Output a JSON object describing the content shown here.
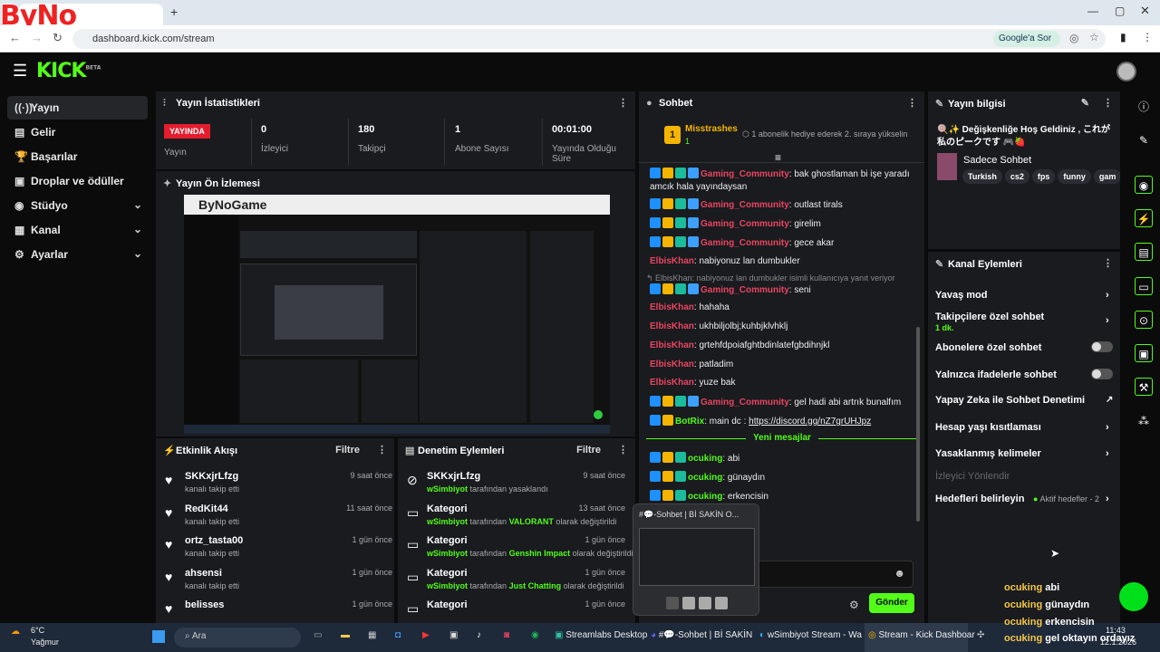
{
  "browser": {
    "tab_title": "",
    "url": "dashboard.kick.com/stream",
    "google_button": "Google'a Sor",
    "overlay_logo": "ByNo"
  },
  "kick": {
    "logo": "KICK",
    "beta": "BETA"
  },
  "sidebar": {
    "items": [
      {
        "label": "Yayın",
        "icon": "broadcast-icon",
        "active": true
      },
      {
        "label": "Gelir",
        "icon": "income-icon"
      },
      {
        "label": "Başarılar",
        "icon": "trophy-icon"
      },
      {
        "label": "Droplar ve ödüller",
        "icon": "gift-icon"
      },
      {
        "label": "Stüdyo",
        "icon": "studio-icon",
        "expand": true
      },
      {
        "label": "Kanal",
        "icon": "channel-icon",
        "expand": true
      },
      {
        "label": "Ayarlar",
        "icon": "gear-icon",
        "expand": true
      }
    ]
  },
  "stats": {
    "title": "Yayın İstatistikleri",
    "live_badge": "YAYINDA",
    "items": [
      {
        "label": "Yayın",
        "value": ""
      },
      {
        "label": "İzleyici",
        "value": "0"
      },
      {
        "label": "Takipçi",
        "value": "180"
      },
      {
        "label": "Abone Sayısı",
        "value": "1"
      },
      {
        "label": "Yayında Olduğu Süre",
        "value": "00:01:00"
      }
    ]
  },
  "preview": {
    "title": "Yayın Ön İzlemesi",
    "watermark": "ByNoGame"
  },
  "activity": {
    "title": "Etkinlik Akışı",
    "filter": "Filtre",
    "items": [
      {
        "name": "SKKxjrLfzg",
        "desc": "kanalı takip etti",
        "time": "9 saat önce"
      },
      {
        "name": "RedKit44",
        "desc": "kanalı takip etti",
        "time": "11 saat önce"
      },
      {
        "name": "ortz_tasta00",
        "desc": "kanalı takip etti",
        "time": "1 gün önce"
      },
      {
        "name": "ahsensi",
        "desc": "kanalı takip etti",
        "time": "1 gün önce"
      },
      {
        "name": "belisses",
        "desc": "",
        "time": "1 gün önce"
      }
    ]
  },
  "moderation": {
    "title": "Denetim Eylemleri",
    "filter": "Filtre",
    "items": [
      {
        "title": "SKKxjrLfzg",
        "actor": "wSimbiyot",
        "pre": " tarafından yasaklandı",
        "hl": "",
        "post": "",
        "time": "9 saat önce",
        "icon": "ban-icon"
      },
      {
        "title": "Kategori",
        "actor": "wSimbiyot",
        "pre": " tarafından ",
        "hl": "VALORANT",
        "post": " olarak değiştirildi",
        "time": "13 saat önce",
        "icon": "category-icon"
      },
      {
        "title": "Kategori",
        "actor": "wSimbiyot",
        "pre": " tarafından ",
        "hl": "Genshin Impact",
        "post": " olarak değiştirildi",
        "time": "1 gün önce",
        "icon": "category-icon"
      },
      {
        "title": "Kategori",
        "actor": "wSimbiyot",
        "pre": " tarafından ",
        "hl": "Just Chatting",
        "post": " olarak değiştirildi",
        "time": "1 gün önce",
        "icon": "category-icon"
      },
      {
        "title": "Kategori",
        "actor": "",
        "pre": "",
        "hl": "",
        "post": "",
        "time": "1 gün önce",
        "icon": "category-icon"
      }
    ]
  },
  "chat": {
    "title": "Sohbet",
    "pinned_user": "Misstrashes",
    "pinned_rank": "1",
    "pinned_sub": "1",
    "pinned_text": "1 abonelik hediye ederek 2. sıraya yükselin",
    "new_messages": "Yeni mesajlar",
    "reply_text": "ElbisKhan: nabiyonuz lan dumbukler isimli kullanıcıya yanıt veriyor",
    "send": "Gönder",
    "messages": [
      {
        "user": "Gaming_Community",
        "cls": "u-gc",
        "text": ": bak ghostlaman bi işe yaradı amcık hala yayındaysan",
        "badges": 4
      },
      {
        "user": "Gaming_Community",
        "cls": "u-gc",
        "text": ": outlast tirals",
        "badges": 4
      },
      {
        "user": "Gaming_Community",
        "cls": "u-gc",
        "text": ": girelim",
        "badges": 4
      },
      {
        "user": "Gaming_Community",
        "cls": "u-gc",
        "text": ": gece akar",
        "badges": 4
      },
      {
        "user": "ElbisKhan",
        "cls": "u-el",
        "text": ": nabiyonuz lan dumbukler",
        "badges": 0
      },
      {
        "user": "Gaming_Community",
        "cls": "u-gc",
        "text": ": seni",
        "badges": 4
      },
      {
        "user": "ElbisKhan",
        "cls": "u-el",
        "text": ": hahaha",
        "badges": 0
      },
      {
        "user": "ElbisKhan",
        "cls": "u-el",
        "text": ": ukhbiljolbj;kuhbjklvhklj",
        "badges": 0
      },
      {
        "user": "ElbisKhan",
        "cls": "u-el",
        "text": ": grtehfdpoiafghtbdinlatefgbdihnjkl",
        "badges": 0
      },
      {
        "user": "ElbisKhan",
        "cls": "u-el",
        "text": ": patladim",
        "badges": 0
      },
      {
        "user": "ElbisKhan",
        "cls": "u-el",
        "text": ": yuze bak",
        "badges": 0
      },
      {
        "user": "Gaming_Community",
        "cls": "u-gc",
        "text": ": gel hadi abi artrık bunalfım",
        "badges": 4
      },
      {
        "user": "BotRix",
        "cls": "u-br",
        "text": ": main dc : ",
        "link": "https://discord.gg/nZ7grUHJpz",
        "badges": 2
      },
      {
        "user": "ocuking",
        "cls": "u-oc",
        "text": ": abi",
        "badges": 3
      },
      {
        "user": "ocuking",
        "cls": "u-oc",
        "text": ": günaydın",
        "badges": 3
      },
      {
        "user": "ocuking",
        "cls": "u-oc",
        "text": ": erkencisin",
        "badges": 3
      },
      {
        "user": "",
        "cls": "u-oc",
        "text": "n ordayız",
        "badges": 0
      }
    ]
  },
  "popup": {
    "title": "#💬-Sohbet | Bİ SAKİN O..."
  },
  "info": {
    "title": "Yayın bilgisi",
    "stream_title": "🍭✨ Değişkenliğe Hoş Geldiniz , これが私のピークです 🎮🍓",
    "category": "Sadece Sohbet",
    "tags": [
      "Turkish",
      "cs2",
      "fps",
      "funny",
      "gam"
    ]
  },
  "actions": {
    "title": "Kanal Eylemleri",
    "items": [
      {
        "label": "Yavaş mod",
        "kind": "chev"
      },
      {
        "label": "Takipçilere özel sohbet",
        "sub": "1 dk.",
        "kind": "chev"
      },
      {
        "label": "Abonelere özel sohbet",
        "kind": "toggle"
      },
      {
        "label": "Yalnızca ifadelerle sohbet",
        "kind": "toggle"
      },
      {
        "label": "Yapay Zeka ile Sohbet Denetimi",
        "kind": "ext"
      },
      {
        "label": "Hesap yaşı kısıtlaması",
        "kind": "chev"
      },
      {
        "label": "Yasaklanmış kelimeler",
        "kind": "chev"
      },
      {
        "label": "İzleyici Yönlendir",
        "kind": "disabled"
      },
      {
        "label": "Hedefleri belirleyin",
        "extra": "Aktif hedefler - 2",
        "kind": "chev"
      }
    ]
  },
  "overlay_chat": [
    {
      "user": "ocuking",
      "text": "abi"
    },
    {
      "user": "ocuking",
      "text": "günaydın"
    },
    {
      "user": "ocuking",
      "text": "erkencisin"
    },
    {
      "user": "ocuking",
      "text": "gel oktayın ordayız"
    }
  ],
  "taskbar": {
    "weather_temp": "6°C",
    "weather_desc": "Yağmur",
    "search": "Ara",
    "apps": [
      {
        "label": "Streamlabs Desktop"
      },
      {
        "label": "#💬-Sohbet | Bİ SAKİN"
      },
      {
        "label": "wSimbiyot Stream - Wa"
      },
      {
        "label": "Stream - Kick Dashboar"
      }
    ],
    "time": "11:43",
    "date": "12.1.2026"
  },
  "colors": {
    "accent": "#53fc18",
    "live": "#e41d2e",
    "panel": "#191b1f"
  }
}
